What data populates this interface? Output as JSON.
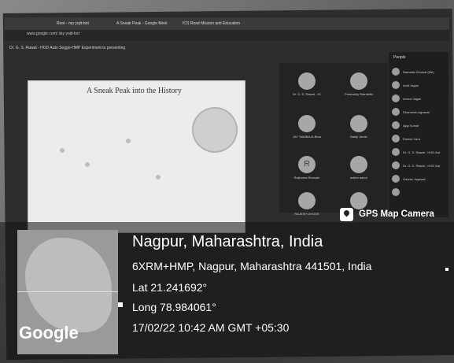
{
  "browser": {
    "tabs": [
      "",
      "Root - mp yojit-bot",
      "A Sneak Peak - Google Meet",
      "ICS Road Mission anti Education",
      ""
    ],
    "url": "www.google.com/ sky yojit-bot"
  },
  "meeting": {
    "title": "Dr. G. S. Rawat - HOD Auto Seggo-HMP Experiment to presenting",
    "slide_title": "A Sneak Peak into the History"
  },
  "tiles": [
    {
      "initial": "",
      "name": "Dr. G. S. Rawat - HOD"
    },
    {
      "initial": "",
      "name": "Prashanty Ratnakikar"
    },
    {
      "initial": "",
      "name": "JAY SAMBAJA Bhawabe"
    },
    {
      "initial": "",
      "name": "Balaji Jamle"
    },
    {
      "initial": "R",
      "name": "Rajkumar Bhosale"
    },
    {
      "initial": "",
      "name": "anklet aaron"
    },
    {
      "initial": "",
      "name": "RAJESH GHODE"
    },
    {
      "initial": "",
      "name": ""
    }
  ],
  "people": {
    "heading": "People",
    "names": [
      "Namarta Dhumal (Me)",
      "Amit Jagan",
      "Anmol Jagan",
      "Dharmesh Agrawal",
      "Ajay Kumar",
      "Dinesh Vora",
      "Dr. G. S. Rawat - HOD Aut",
      "Dr. G. S. Rawat - HOD Aut",
      "Gaurav Jayswal",
      ""
    ]
  },
  "gps": {
    "badge_label": "GPS Map Camera",
    "city": "Nagpur, Maharashtra, India",
    "address": "6XRM+HMP, Nagpur, Maharashtra 441501, India",
    "lat": "Lat 21.241692°",
    "long": "Long 78.984061°",
    "datetime": "17/02/22 10:42 AM GMT +05:30"
  },
  "map": {
    "brand": "Google"
  }
}
